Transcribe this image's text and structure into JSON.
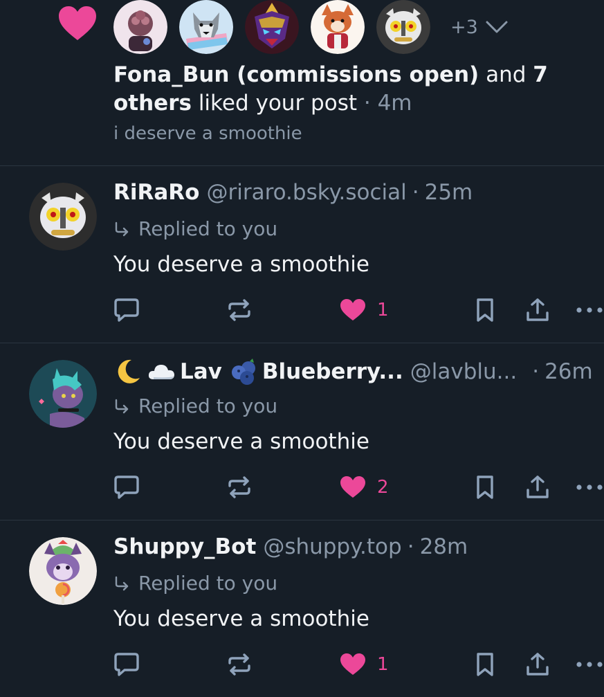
{
  "notification": {
    "more_count": "+3",
    "liker_name": "Fona_Bun (commissions open)",
    "and_text": "and",
    "others_count": "7",
    "others_text": "others",
    "action_text": "liked your post",
    "time": "4m",
    "post_text": "i deserve a smoothie"
  },
  "replies": [
    {
      "name": "RiRaRo",
      "handle": "@riraro.bsky.social",
      "time": "25m",
      "replied_label": "Replied to you",
      "text": "You deserve a smoothie",
      "like_count": "1"
    },
    {
      "name_part1": "Lav",
      "name_part2": "Blueberry...",
      "handle": "@lavblu...",
      "time": "26m",
      "replied_label": "Replied to you",
      "text": "You deserve a smoothie",
      "like_count": "2"
    },
    {
      "name": "Shuppy_Bot",
      "handle": "@shuppy.top",
      "time": "28m",
      "replied_label": "Replied to you",
      "text": "You deserve a smoothie",
      "like_count": "1"
    }
  ],
  "colors": {
    "background": "#161e27",
    "accent_pink": "#ec4899",
    "muted": "#8a98a8",
    "icon": "#8fa3bb"
  }
}
